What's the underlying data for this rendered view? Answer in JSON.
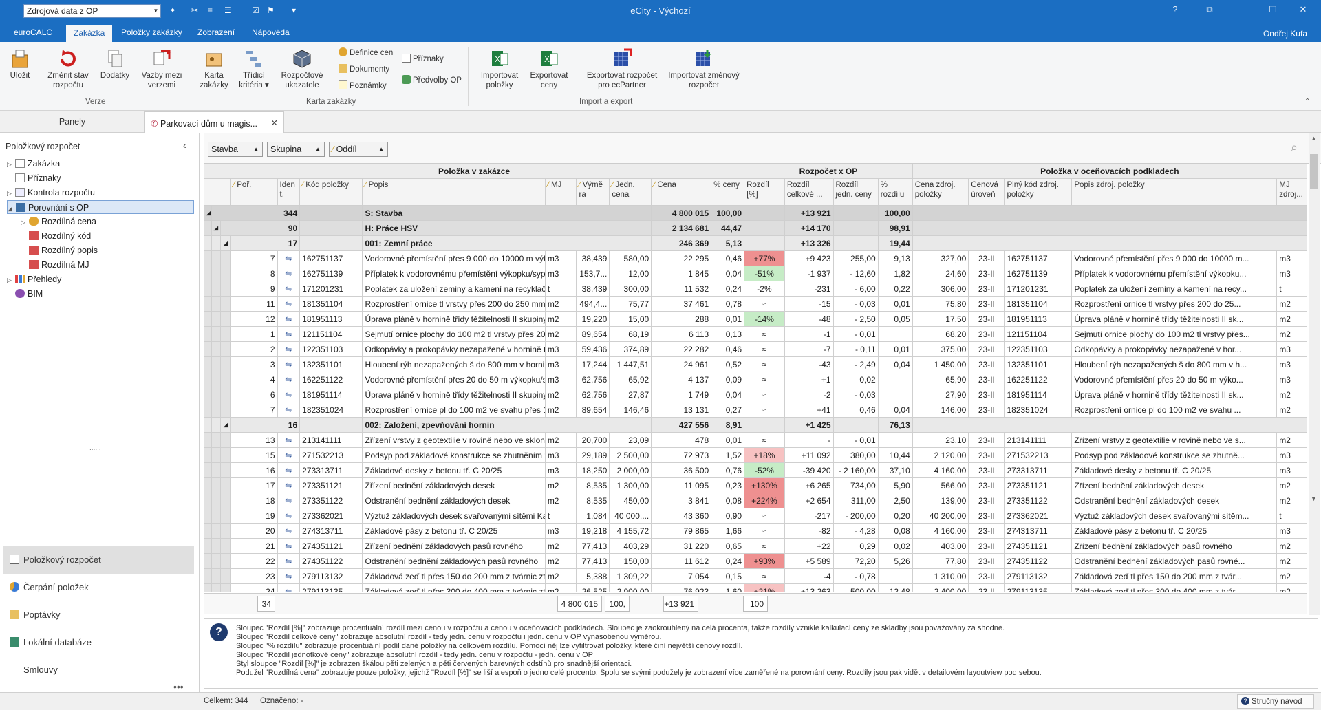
{
  "titlebar": {
    "combo_value": "Zdrojová data z OP",
    "title": "eCity - Výchozí"
  },
  "menu": {
    "tabs": [
      "euroCALC",
      "Zakázka",
      "Položky zakázky",
      "Zobrazení",
      "Nápověda"
    ],
    "user": "Ondřej Kufa"
  },
  "ribbon": {
    "buttons": {
      "ulozit": "Uložit",
      "zmenit": "Změnit stav rozpočtu",
      "dodatky": "Dodatky",
      "vazby": "Vazby mezi verzemi",
      "karta": "Karta zakázky",
      "tridici": "Třídicí kritéria ▾",
      "rozpoctove": "Rozpočtové ukazatele",
      "definice": "Definice cen",
      "dokumenty": "Dokumenty",
      "poznamky": "Poznámky",
      "priznaky": "Příznaky",
      "predvolby": "Předvolby OP",
      "import": "Importovat položky",
      "export": "Exportovat ceny",
      "exportEc": "Exportovat rozpočet pro ecPartner",
      "importZm": "Importovat změnový rozpočet"
    },
    "groups": {
      "verze": "Verze",
      "karta": "Karta zakázky",
      "ie": "Import a export"
    }
  },
  "panes": {
    "label": "Panely",
    "doc_tab": "Parkovací dům u magis..."
  },
  "sidebar": {
    "title": "Položkový rozpočet",
    "tree": [
      "Zakázka",
      "Příznaky",
      "Kontrola rozpočtu",
      "Porovnání s OP",
      "Rozdílná cena",
      "Rozdílný kód",
      "Rozdílný popis",
      "Rozdílná MJ",
      "Přehledy",
      "BIM"
    ],
    "nav": [
      "Položkový rozpočet",
      "Čerpání položek",
      "Poptávky",
      "Lokální databáze",
      "Smlouvy"
    ]
  },
  "filters": [
    "Stavba",
    "Skupina",
    "Oddíl"
  ],
  "grid": {
    "bands": [
      "Položka v zakázce",
      "Rozpočet x OP",
      "Položka v oceňovacích podkladech"
    ],
    "headers": [
      "Poř.",
      "Iden t.",
      "Kód položky",
      "Popis",
      "MJ",
      "Výmě ra",
      "Jedn. cena",
      "Cena",
      "% ceny",
      "Rozdíl [%]",
      "Rozdíl celkové ...",
      "Rozdíl jedn. ceny",
      "% rozdílu",
      "Cena zdroj. položky",
      "Cenová úroveň",
      "Plný kód zdroj. položky",
      "Popis zdroj. položky",
      "MJ zdroj..."
    ],
    "groups": [
      {
        "level": 1,
        "count": "344",
        "name": "S: Stavba",
        "cena": "4 800 015",
        "pct": "100,00",
        "rozdil": "+13 921",
        "pctRozdilu": "100,00"
      },
      {
        "level": 2,
        "count": "90",
        "name": "H: Práce HSV",
        "cena": "2 134 681",
        "pct": "44,47",
        "rozdil": "+14 170",
        "pctRozdilu": "98,91"
      },
      {
        "level": 3,
        "count": "17",
        "name": "001: Zemní práce",
        "cena": "246 369",
        "pct": "5,13",
        "rozdil": "+13 326",
        "pctRozdilu": "19,44"
      }
    ],
    "rows1": [
      [
        "7",
        "162751137",
        "Vodorovné přemístění přes 9 000 do 10000 m výk...",
        "m3",
        "38,439",
        "580,00",
        "22 295",
        "0,46",
        "+77%",
        "+9 423",
        "255,00",
        "9,13",
        "327,00",
        "23-II",
        "162751137",
        "Vodorovné přemístění přes 9 000 do 10000 m...",
        "m3",
        "red"
      ],
      [
        "8",
        "162751139",
        "Příplatek k vodorovnému přemístění výkopku/sypa...",
        "m3",
        "153,7...",
        "12,00",
        "1 845",
        "0,04",
        "-51%",
        "-1 937",
        "-  12,60",
        "1,82",
        "24,60",
        "23-II",
        "162751139",
        "Příplatek k vodorovnému přemístění výkopku...",
        "m3",
        "green"
      ],
      [
        "9",
        "171201231",
        "Poplatek za uložení zeminy a kamení na recyklační ...",
        "t",
        "38,439",
        "300,00",
        "11 532",
        "0,24",
        "-2%",
        "-231",
        "-  6,00",
        "0,22",
        "306,00",
        "23-II",
        "171201231",
        "Poplatek za uložení zeminy a kamení na recy...",
        "t",
        ""
      ],
      [
        "11",
        "181351104",
        "Rozprostření ornice tl vrstvy přes 200 do 250 mm ...",
        "m2",
        "494,4...",
        "75,77",
        "37 461",
        "0,78",
        "≈",
        "-15",
        "-  0,03",
        "0,01",
        "75,80",
        "23-II",
        "181351104",
        "Rozprostření ornice tl vrstvy přes 200 do 25...",
        "m2",
        ""
      ],
      [
        "12",
        "181951113",
        "Úprava pláně v hornině třídy těžitelnosti II skupiny ...",
        "m2",
        "19,220",
        "15,00",
        "288",
        "0,01",
        "-14%",
        "-48",
        "-  2,50",
        "0,05",
        "17,50",
        "23-II",
        "181951113",
        "Úprava pláně v hornině třídy těžitelnosti II sk...",
        "m2",
        "green"
      ],
      [
        "1",
        "121151104",
        "Sejmutí ornice plochy do 100 m2 tl vrstvy přes 200...",
        "m2",
        "89,654",
        "68,19",
        "6 113",
        "0,13",
        "≈",
        "-1",
        "-  0,01",
        "",
        "68,20",
        "23-II",
        "121151104",
        "Sejmutí ornice plochy do 100 m2 tl vrstvy přes...",
        "m2",
        ""
      ],
      [
        "2",
        "122351103",
        "Odkopávky a prokopávky nezapažené v hornině tří...",
        "m3",
        "59,436",
        "374,89",
        "22 282",
        "0,46",
        "≈",
        "-7",
        "-  0,11",
        "0,01",
        "375,00",
        "23-II",
        "122351103",
        "Odkopávky a prokopávky nezapažené v hor...",
        "m3",
        ""
      ],
      [
        "3",
        "132351101",
        "Hloubení rýh nezapažených š do 800 mm v hornin...",
        "m3",
        "17,244",
        "1 447,51",
        "24 961",
        "0,52",
        "≈",
        "-43",
        "-  2,49",
        "0,04",
        "1 450,00",
        "23-II",
        "132351101",
        "Hloubení rýh nezapažených š do 800 mm v h...",
        "m3",
        ""
      ],
      [
        "4",
        "162251122",
        "Vodorovné přemístění přes 20 do 50 m výkopku/s...",
        "m3",
        "62,756",
        "65,92",
        "4 137",
        "0,09",
        "≈",
        "+1",
        "0,02",
        "",
        "65,90",
        "23-II",
        "162251122",
        "Vodorovné přemístění přes 20 do 50 m výko...",
        "m3",
        ""
      ],
      [
        "6",
        "181951114",
        "Úprava pláně v hornině třídy těžitelnosti II skupiny ...",
        "m2",
        "62,756",
        "27,87",
        "1 749",
        "0,04",
        "≈",
        "-2",
        "-  0,03",
        "",
        "27,90",
        "23-II",
        "181951114",
        "Úprava pláně v hornině třídy těžitelnosti II sk...",
        "m2",
        ""
      ],
      [
        "7",
        "182351024",
        "Rozprostření ornice pl do 100 m2 ve svahu přes 1:...",
        "m2",
        "89,654",
        "146,46",
        "13 131",
        "0,27",
        "≈",
        "+41",
        "0,46",
        "0,04",
        "146,00",
        "23-II",
        "182351024",
        "Rozprostření ornice pl do 100 m2 ve svahu ...",
        "m2",
        ""
      ]
    ],
    "group2": {
      "count": "16",
      "name": "002: Založení, zpevňování hornin",
      "cena": "427 556",
      "pct": "8,91",
      "rozdil": "+1 425",
      "pctRozdilu": "76,13"
    },
    "rows2": [
      [
        "13",
        "213141111",
        "Zřízení vrstvy z geotextilie v rovině nebo ve sklonu ...",
        "m2",
        "20,700",
        "23,09",
        "478",
        "0,01",
        "≈",
        "-",
        "-  0,01",
        "",
        "23,10",
        "23-II",
        "213141111",
        "Zřízení vrstvy z geotextilie v rovině nebo ve s...",
        "m2",
        ""
      ],
      [
        "15",
        "271532213",
        "Podsyp pod základové konstrukce se zhutněním z ...",
        "m3",
        "29,189",
        "2 500,00",
        "72 973",
        "1,52",
        "+18%",
        "+11 092",
        "380,00",
        "10,44",
        "2 120,00",
        "23-II",
        "271532213",
        "Podsyp pod základové konstrukce se zhutně...",
        "m3",
        "pink"
      ],
      [
        "16",
        "273313711",
        "Základové desky z betonu tř. C 20/25",
        "m3",
        "18,250",
        "2 000,00",
        "36 500",
        "0,76",
        "-52%",
        "-39 420",
        "- 2 160,00",
        "37,10",
        "4 160,00",
        "23-II",
        "273313711",
        "Základové desky z betonu tř. C 20/25",
        "m3",
        "green"
      ],
      [
        "17",
        "273351121",
        "Zřízení bednění základových desek",
        "m2",
        "8,535",
        "1 300,00",
        "11 095",
        "0,23",
        "+130%",
        "+6 265",
        "734,00",
        "5,90",
        "566,00",
        "23-II",
        "273351121",
        "Zřízení bednění základových desek",
        "m2",
        "red"
      ],
      [
        "18",
        "273351122",
        "Odstranění bednění základových desek",
        "m2",
        "8,535",
        "450,00",
        "3 841",
        "0,08",
        "+224%",
        "+2 654",
        "311,00",
        "2,50",
        "139,00",
        "23-II",
        "273351122",
        "Odstranění bednění základových desek",
        "m2",
        "red"
      ],
      [
        "19",
        "273362021",
        "Výztuž základových desek svařovanými sítěmi Kari",
        "t",
        "1,084",
        "40 000,...",
        "43 360",
        "0,90",
        "≈",
        "-217",
        "-  200,00",
        "0,20",
        "40 200,00",
        "23-II",
        "273362021",
        "Výztuž základových desek svařovanými sítěm...",
        "t",
        ""
      ],
      [
        "20",
        "274313711",
        "Základové pásy z betonu tř. C 20/25",
        "m3",
        "19,218",
        "4 155,72",
        "79 865",
        "1,66",
        "≈",
        "-82",
        "-  4,28",
        "0,08",
        "4 160,00",
        "23-II",
        "274313711",
        "Základové pásy z betonu tř. C 20/25",
        "m3",
        ""
      ],
      [
        "21",
        "274351121",
        "Zřízení bednění základových pasů rovného",
        "m2",
        "77,413",
        "403,29",
        "31 220",
        "0,65",
        "≈",
        "+22",
        "0,29",
        "0,02",
        "403,00",
        "23-II",
        "274351121",
        "Zřízení bednění základových pasů rovného",
        "m2",
        ""
      ],
      [
        "22",
        "274351122",
        "Odstranění bednění základových pasů rovného",
        "m2",
        "77,413",
        "150,00",
        "11 612",
        "0,24",
        "+93%",
        "+5 589",
        "72,20",
        "5,26",
        "77,80",
        "23-II",
        "274351122",
        "Odstranění bednění základových pasů rovné...",
        "m2",
        "red"
      ],
      [
        "23",
        "279113132",
        "Základová zeď tl přes 150 do 200 mm z tvárnic ztr...",
        "m2",
        "5,388",
        "1 309,22",
        "7 054",
        "0,15",
        "≈",
        "-4",
        "-  0,78",
        "",
        "1 310,00",
        "23-II",
        "279113132",
        "Základová zeď tl přes 150 do 200 mm z tvár...",
        "m2",
        ""
      ],
      [
        "24",
        "279113135",
        "Základová zeď tl přes 300 do 400 mm z tvárnic ztr...",
        "m2",
        "26,525",
        "2 900,00",
        "76 923",
        "1,60",
        "+21%",
        "+13 263",
        "500,00",
        "12,48",
        "2 400,00",
        "23-II",
        "279113135",
        "Základová zeď tl přes 300 do 400 mm z tvár...",
        "m2",
        "pink"
      ]
    ],
    "footer": {
      "count": "34",
      "cena": "4 800 015",
      "pct": "100,",
      "rozdil": "+13 921",
      "pctRozdilu": "100"
    }
  },
  "info": [
    "Sloupec \"Rozdíl [%]\" zobrazuje procentuální rozdíl mezi cenou v rozpočtu a cenou v oceňovacích podkladech. Sloupec je zaokrouhlený na celá procenta, takže rozdíly vzniklé kalkulací ceny ze skladby jsou považovány za shodné.",
    "Sloupec \"Rozdíl celkové ceny\" zobrazuje absolutní rozdíl - tedy jedn. cenu v rozpočtu i jedn. cenu v OP vynásobenou výměrou.",
    "Sloupec \"% rozdílu\" zobrazuje procentuální podíl dané položky na celkovém rozdílu. Pomocí něj lze vyfiltrovat položky, které činí největší cenový rozdíl.",
    "Sloupec \"Rozdíl jednotkové ceny\" zobrazuje absolutní rozdíl - tedy jedn. cenu v rozpočtu - jedn. cenu v OP",
    "Styl sloupce \"Rozdíl [%]\" je zobrazen škálou pěti zelených a pěti červených barevných odstínů pro snadnější orientaci.",
    "Podužel \"Rozdílná cena\" zobrazuje pouze položky, jejichž \"Rozdíl [%]\" se liší alespoň o jedno celé procento. Spolu se svými podužely je zobrazení více zaměřené na porovnání ceny. Rozdíly jsou pak vidět v detailovém layoutview pod sebou."
  ],
  "status": {
    "celkem": "Celkem: 344",
    "oznaceno": "Označeno: -",
    "help": "Stručný návod"
  }
}
